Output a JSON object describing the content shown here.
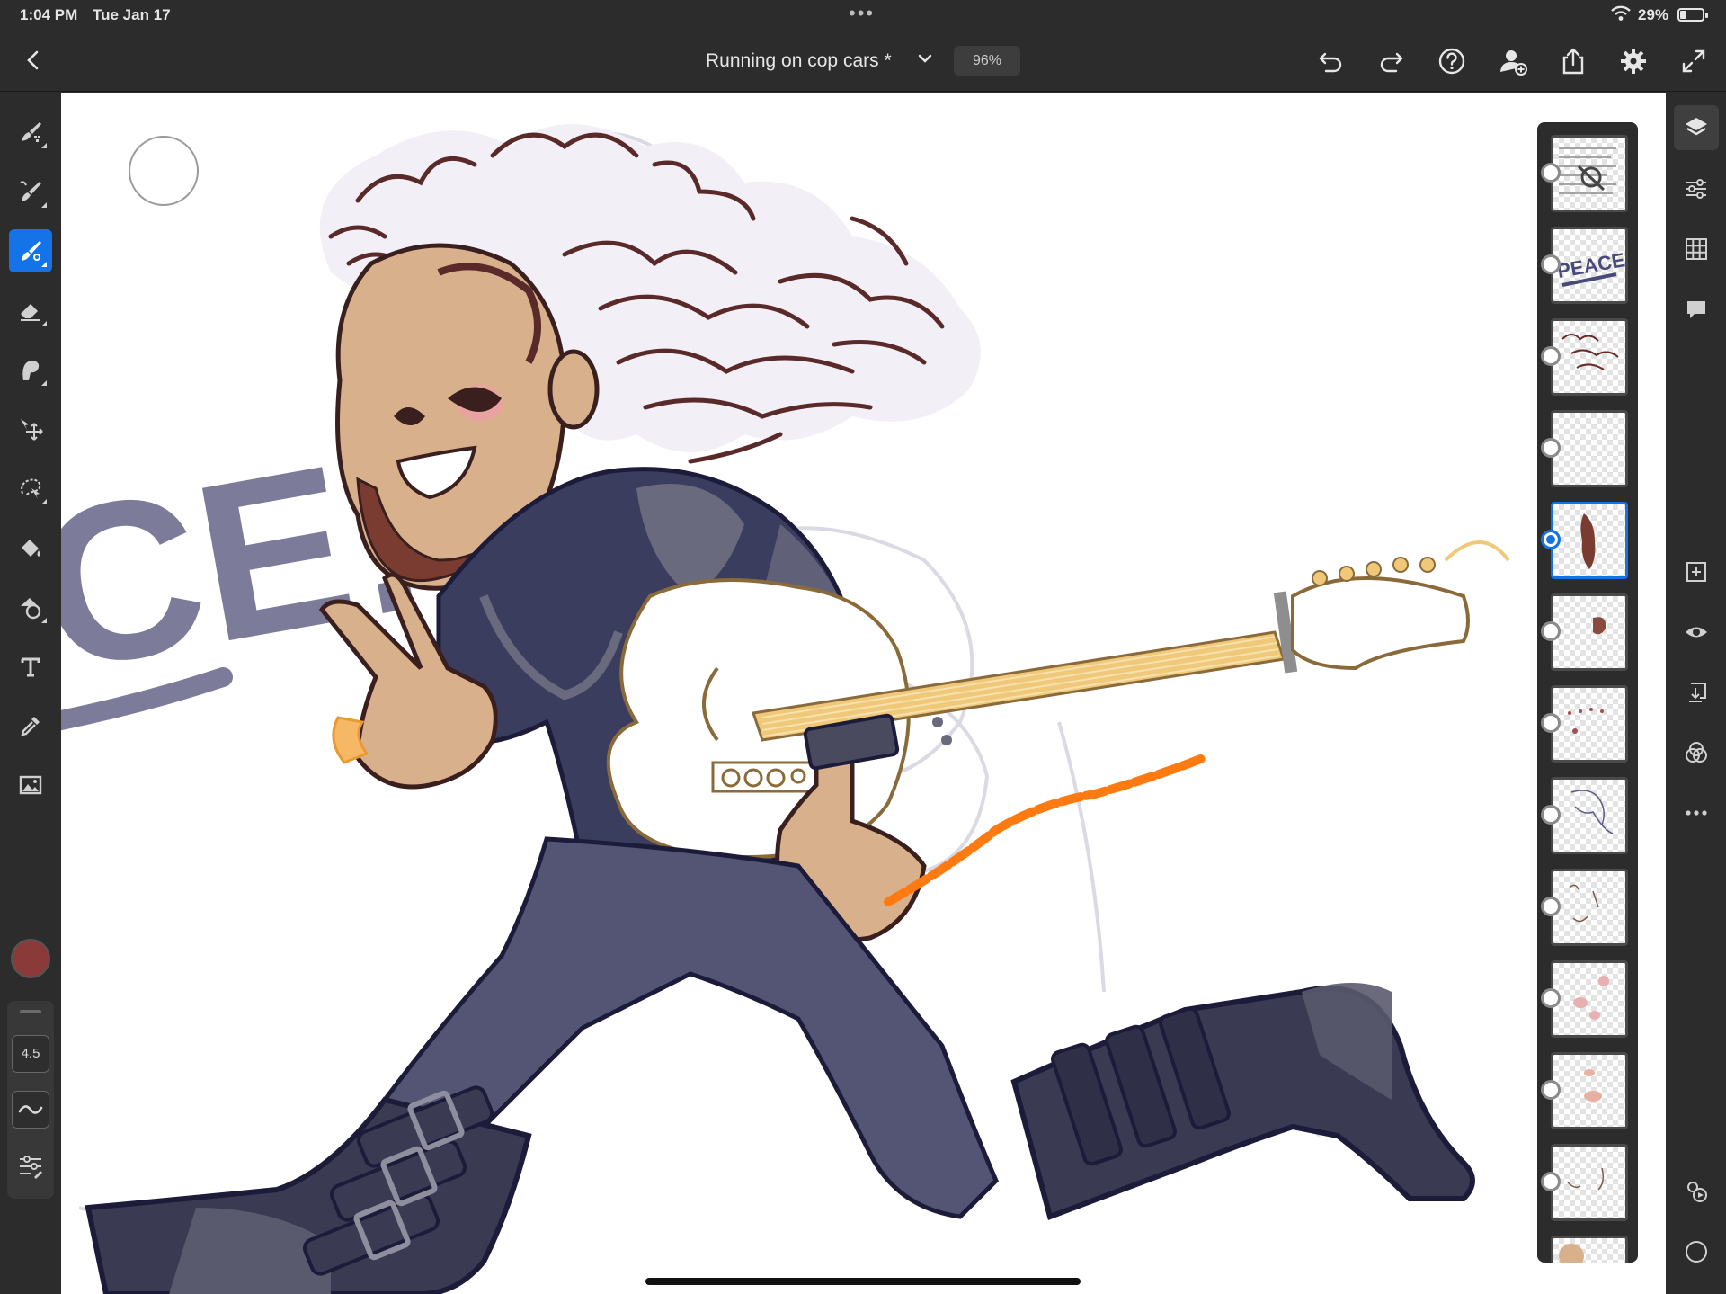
{
  "status_bar": {
    "time": "1:04 PM",
    "date": "Tue Jan 17",
    "multitask_dots": "•••",
    "battery_percent": "29%",
    "battery_level": 0.29,
    "icons": [
      "wifi-icon",
      "battery-icon"
    ]
  },
  "toolbar": {
    "document_title": "Running on cop cars *",
    "zoom": "96%",
    "icons": [
      "back-chevron-icon",
      "title-dropdown-chevron-icon",
      "undo-icon",
      "redo-icon",
      "help-icon",
      "invite-user-icon",
      "share-icon",
      "settings-gear-icon",
      "fullscreen-icon"
    ]
  },
  "left_tools": {
    "tools": [
      {
        "name": "pixel-brush-tool",
        "icon": "pixel-brush-icon",
        "active": false
      },
      {
        "name": "live-brush-tool",
        "icon": "live-brush-icon",
        "active": false
      },
      {
        "name": "vector-brush-tool",
        "icon": "vector-brush-icon",
        "active": true
      },
      {
        "name": "eraser-tool",
        "icon": "eraser-icon",
        "active": false
      },
      {
        "name": "smudge-tool",
        "icon": "smudge-icon",
        "active": false
      },
      {
        "name": "move-tool",
        "icon": "move-icon",
        "active": false
      },
      {
        "name": "selection-tool",
        "icon": "lasso-icon",
        "active": false
      },
      {
        "name": "fill-tool",
        "icon": "paint-bucket-icon",
        "active": false
      },
      {
        "name": "shape-tool",
        "icon": "shapes-icon",
        "active": false
      },
      {
        "name": "text-tool",
        "icon": "text-icon",
        "active": false
      },
      {
        "name": "eyedropper-tool",
        "icon": "eyedropper-icon",
        "active": false
      },
      {
        "name": "image-tool",
        "icon": "image-icon",
        "active": false
      }
    ],
    "current_color": "#8b3a3a",
    "brush_size": "4.5",
    "brush_icons": [
      "flow-curve-icon",
      "brush-settings-icon"
    ]
  },
  "layers": {
    "thumbnails": [
      {
        "label": "sketch-note-layer",
        "hidden": true,
        "thumb_text": "PEACE!",
        "selected": false
      },
      {
        "label": "peace-text-layer",
        "hidden": false,
        "thumb_text": "PEACE!",
        "selected": false
      },
      {
        "label": "hair-lines-layer",
        "hidden": false,
        "selected": false
      },
      {
        "label": "empty-layer",
        "hidden": false,
        "selected": false
      },
      {
        "label": "beard-layer",
        "hidden": false,
        "selected": true
      },
      {
        "label": "hair-tuft-layer",
        "hidden": false,
        "selected": false
      },
      {
        "label": "details-layer",
        "hidden": false,
        "selected": false
      },
      {
        "label": "jacket-lines-layer",
        "hidden": false,
        "selected": false
      },
      {
        "label": "hands-layer",
        "hidden": false,
        "selected": false
      },
      {
        "label": "blush-layer",
        "hidden": false,
        "selected": false
      },
      {
        "label": "skin-shading-layer",
        "hidden": false,
        "selected": false
      },
      {
        "label": "face-lines-layer",
        "hidden": false,
        "selected": false
      },
      {
        "label": "skin-base-layer",
        "hidden": false,
        "selected": false
      }
    ]
  },
  "right_rail": {
    "buttons": [
      "layers-icon",
      "adjustments-icon",
      "grid-icon",
      "comments-icon",
      "add-layer-icon",
      "visibility-eye-icon",
      "merge-down-icon",
      "blend-modes-icon",
      "more-options-icon",
      "livestream-icon",
      "record-icon"
    ]
  },
  "canvas": {
    "peace_text": "CE!",
    "colors": {
      "hair": "#5a2a2a",
      "skin": "#d9b08c",
      "jacket": "#3b3d5e",
      "jacket_light": "#6a6a7e",
      "pants": "#545474",
      "boots": "#3a3a52",
      "guitar_neck": "#f0c87a",
      "guitar_body": "#ffffff",
      "chain": "#ff7a10",
      "peace_text": "#7d7b9a"
    }
  }
}
